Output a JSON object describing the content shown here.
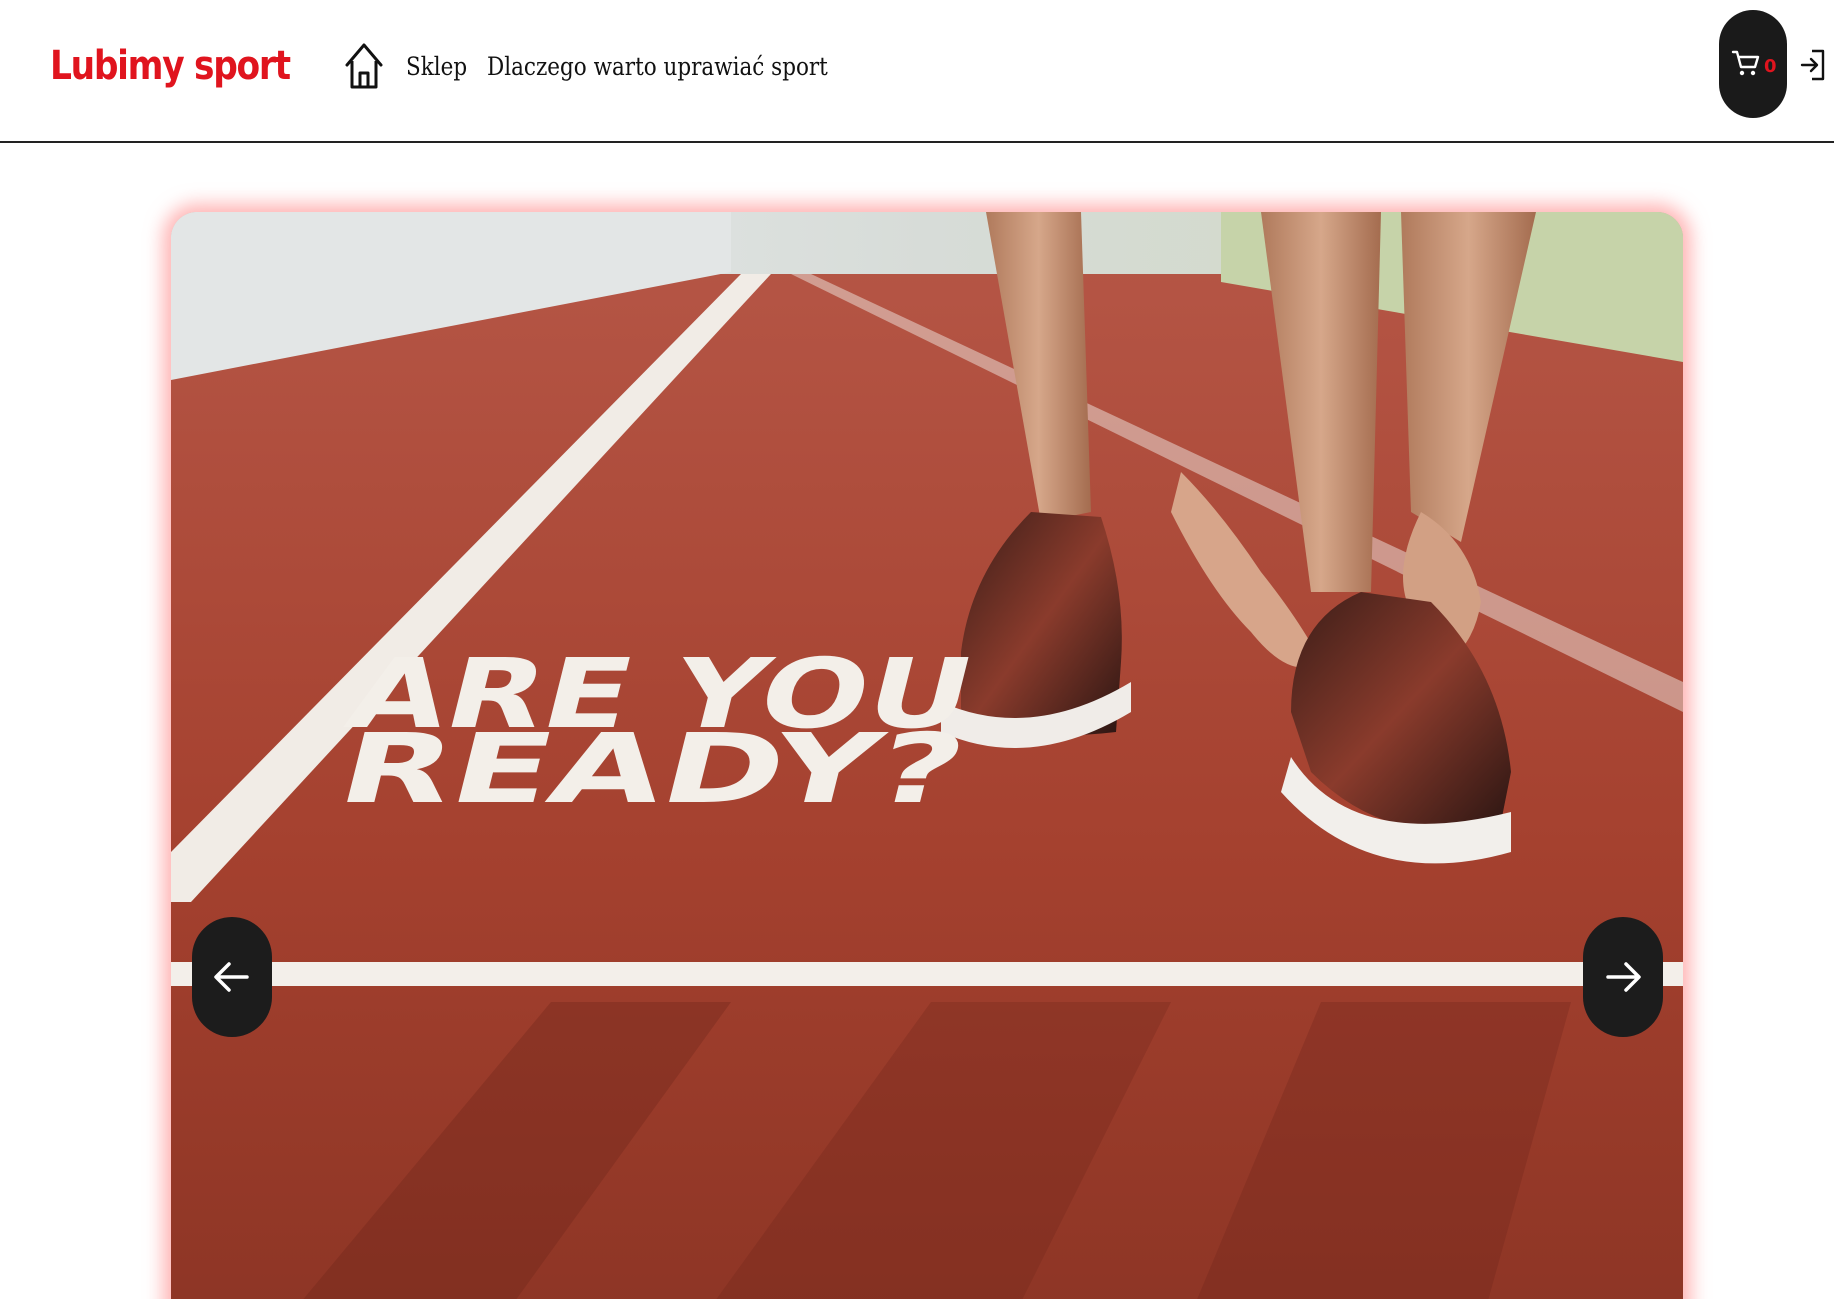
{
  "header": {
    "logo": "Lubimy sport",
    "nav": {
      "home_icon": "home-icon",
      "links": [
        {
          "label": "Sklep"
        },
        {
          "label": "Dlaczego warto uprawiać sport"
        }
      ]
    },
    "cart": {
      "icon": "cart-icon",
      "count": "0"
    },
    "login_icon": "login-icon"
  },
  "slider": {
    "image_text_line1": "ARE YOU",
    "image_text_line2": "READY?",
    "prev_icon": "arrow-left-icon",
    "next_icon": "arrow-right-icon"
  },
  "colors": {
    "brand": "#e0141e",
    "dark": "#1a1a1a",
    "track": "#a5412f",
    "glow": "#ff7878"
  }
}
